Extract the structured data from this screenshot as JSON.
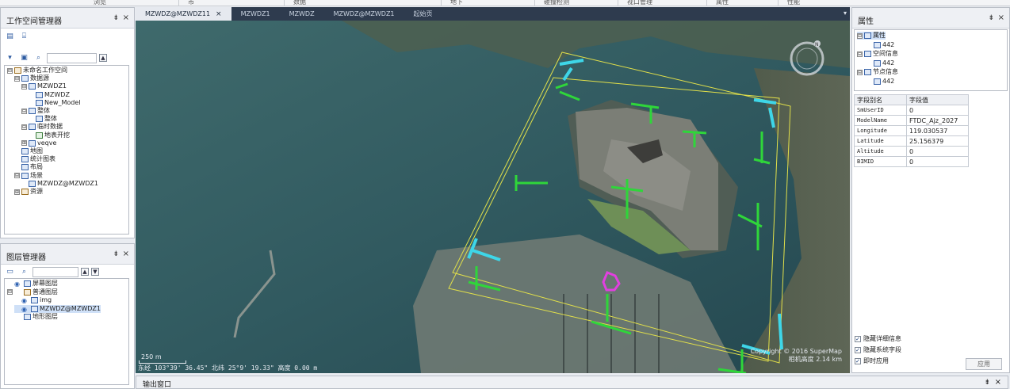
{
  "ribbon": {
    "groups": [
      "浏览",
      "市",
      "数据",
      "地下",
      "碰撞检测",
      "视口管理",
      "属性",
      "性能"
    ]
  },
  "workspace_panel": {
    "title": "工作空间管理器",
    "pin": "⇟",
    "close": "×",
    "tree": [
      {
        "label": "未命名工作空间",
        "level": 0,
        "exp": "⊟",
        "icon": "o"
      },
      {
        "label": "数据源",
        "level": 1,
        "exp": "⊟",
        "icon": "b"
      },
      {
        "label": "MZWDZ1",
        "level": 2,
        "exp": "⊟",
        "icon": "b"
      },
      {
        "label": "MZWDZ",
        "level": 3,
        "exp": "",
        "icon": "b"
      },
      {
        "label": "New_Model",
        "level": 3,
        "exp": "",
        "icon": "b"
      },
      {
        "label": "整体",
        "level": 2,
        "exp": "⊟",
        "icon": "b"
      },
      {
        "label": "整体",
        "level": 3,
        "exp": "",
        "icon": "b"
      },
      {
        "label": "临时数据",
        "level": 2,
        "exp": "⊟",
        "icon": "b"
      },
      {
        "label": "地表开挖",
        "level": 3,
        "exp": "",
        "icon": "g"
      },
      {
        "label": "veqve",
        "level": 2,
        "exp": "⊞",
        "icon": "b"
      },
      {
        "label": "地图",
        "level": 1,
        "exp": "",
        "icon": "b"
      },
      {
        "label": "统计图表",
        "level": 1,
        "exp": "",
        "icon": "b"
      },
      {
        "label": "布局",
        "level": 1,
        "exp": "",
        "icon": "b"
      },
      {
        "label": "场景",
        "level": 1,
        "exp": "⊟",
        "icon": "b"
      },
      {
        "label": "MZWDZ@MZWDZ1",
        "level": 2,
        "exp": "",
        "icon": "b"
      },
      {
        "label": "资源",
        "level": 1,
        "exp": "⊞",
        "icon": "o"
      }
    ]
  },
  "layer_panel": {
    "title": "图层管理器",
    "pin": "⇟",
    "close": "×",
    "tree": [
      {
        "label": "屏幕图层",
        "level": 0,
        "exp": "",
        "icon": "b",
        "eye": true
      },
      {
        "label": "普通图层",
        "level": 0,
        "exp": "⊟",
        "icon": "o",
        "eye": false
      },
      {
        "label": "img",
        "level": 1,
        "exp": "",
        "icon": "b",
        "eye": true
      },
      {
        "label": "MZWDZ@MZWDZ1",
        "level": 1,
        "exp": "",
        "icon": "b",
        "eye": true,
        "selected": true
      },
      {
        "label": "地形图层",
        "level": 0,
        "exp": "",
        "icon": "b",
        "eye": false
      }
    ]
  },
  "map_window": {
    "tabs": [
      {
        "label": "MZWDZ@MZWDZ11",
        "active": true,
        "close": "×"
      },
      {
        "label": "MZWDZ1",
        "active": false
      },
      {
        "label": "MZWDZ",
        "active": false
      },
      {
        "label": "MZWDZ@MZWDZ1",
        "active": false
      },
      {
        "label": "起始页",
        "active": false
      }
    ],
    "dropdown": "▾",
    "scale_label": "250 m",
    "status_text": "东经 103°39' 36.45\"   北纬 25°9' 19.33\"   高度 0.00 m",
    "copyright_line1": "Copyright © 2016 SuperMap",
    "copyright_line2": "相机高度 2.14 km",
    "compass_letter": "N"
  },
  "properties_panel": {
    "title": "属性",
    "pin": "⇟",
    "close": "×",
    "tree": [
      {
        "label": "属性",
        "level": 0,
        "exp": "⊟",
        "selected": true
      },
      {
        "label": "442",
        "level": 1,
        "exp": ""
      },
      {
        "label": "空间信息",
        "level": 0,
        "exp": "⊟"
      },
      {
        "label": "442",
        "level": 1,
        "exp": ""
      },
      {
        "label": "节点信息",
        "level": 0,
        "exp": "⊟"
      },
      {
        "label": "442",
        "level": 1,
        "exp": ""
      }
    ],
    "table_headers": [
      "字段别名",
      "字段值"
    ],
    "rows": [
      {
        "key": "SmUserID",
        "value": "0"
      },
      {
        "key": "ModelName",
        "value": "FTDC_Ajz_2027"
      },
      {
        "key": "Longitude",
        "value": "119.030537"
      },
      {
        "key": "Latitude",
        "value": "25.156379"
      },
      {
        "key": "Altitude",
        "value": "0"
      },
      {
        "key": "BIMID",
        "value": "0"
      }
    ],
    "checkboxes": [
      {
        "label": "隐藏详细信息",
        "checked": true
      },
      {
        "label": "隐藏系统字段",
        "checked": true
      },
      {
        "label": "即时应用",
        "checked": true
      }
    ],
    "apply_label": "应用"
  },
  "output_window": {
    "title": "输出窗口",
    "pin": "⇟",
    "close": "×"
  }
}
